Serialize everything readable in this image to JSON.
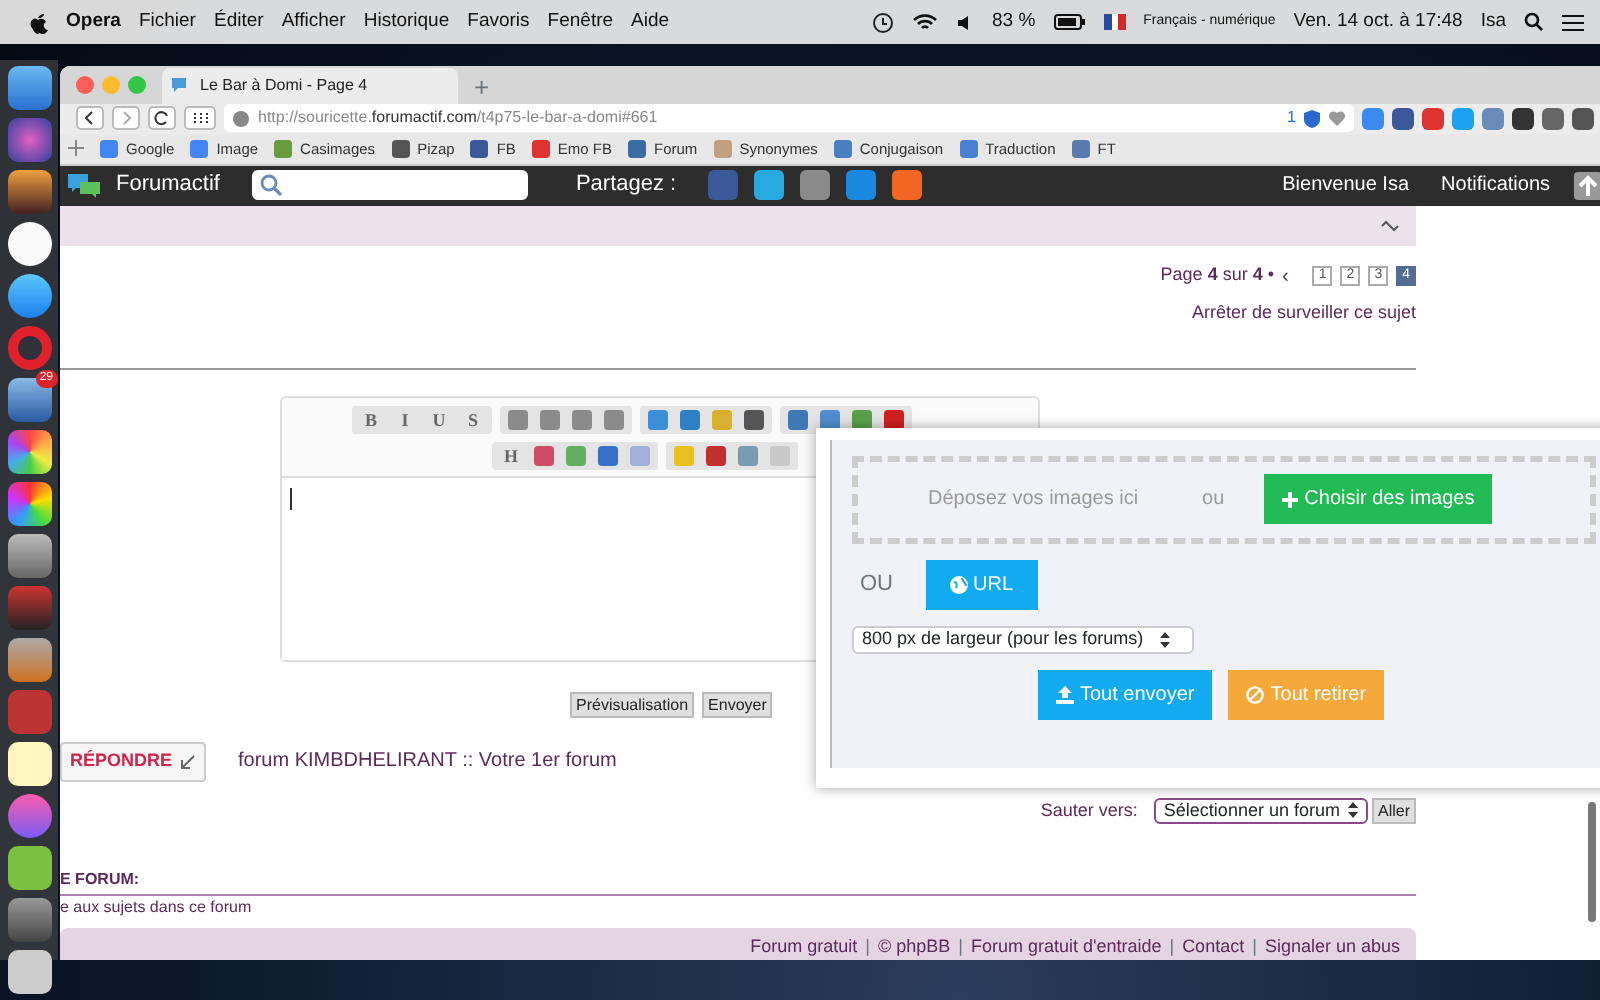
{
  "menubar": {
    "app": "Opera",
    "menus": [
      "Fichier",
      "Éditer",
      "Afficher",
      "Historique",
      "Favoris",
      "Fenêtre",
      "Aide"
    ],
    "battery": "83 %",
    "input_source": "Français - numérique",
    "clock": "Ven. 14 oct. à 17:48",
    "user": "Isa"
  },
  "dock": {
    "badge": "29"
  },
  "browser": {
    "tab": {
      "title": "Le Bar à Domi - Page 4",
      "new_tab": "+"
    },
    "url": "http://souricette.**forumactif.com**/t4p75-le-bar-a-domi#661",
    "shield_count": "1",
    "bookmarks": [
      "Google",
      "Image",
      "Casimages",
      "Pizap",
      "FB",
      "Emo FB",
      "Forum",
      "Synonymes",
      "Conjugaison",
      "Traduction",
      "FT"
    ]
  },
  "forum_nav": {
    "brand": "Forumactif",
    "share_label": "Partagez :",
    "welcome": "Bienvenue Isa",
    "notifications": "Notifications"
  },
  "pagination": {
    "label": "Page **4** sur **4** •",
    "prev": "‹",
    "pages": [
      {
        "label": "1",
        "selected": false
      },
      {
        "label": "2",
        "selected": false
      },
      {
        "label": "3",
        "selected": false
      },
      {
        "label": "4",
        "selected": true
      }
    ]
  },
  "watch_link": "Arrêter de surveiller ce sujet",
  "editor": {
    "toolbar": [
      [
        [
          {
            "kind": "text",
            "label": "B"
          },
          {
            "kind": "text",
            "label": "I"
          },
          {
            "kind": "text",
            "label": "U"
          },
          {
            "kind": "text",
            "label": "S"
          }
        ],
        [
          {
            "kind": "icon",
            "color": "#8a8a8a"
          },
          {
            "kind": "icon",
            "color": "#8a8a8a"
          },
          {
            "kind": "icon",
            "color": "#8a8a8a"
          },
          {
            "kind": "icon",
            "color": "#8a8a8a"
          }
        ],
        [
          {
            "kind": "icon",
            "color": "#3b8fd6"
          },
          {
            "kind": "icon",
            "color": "#2f7fc4"
          },
          {
            "kind": "icon",
            "color": "#d8b030"
          },
          {
            "kind": "icon",
            "color": "#555555"
          }
        ],
        [
          {
            "kind": "icon",
            "color": "#3f79b5"
          },
          {
            "kind": "icon",
            "color": "#4f8fcf"
          },
          {
            "kind": "icon",
            "color": "#5aa04a"
          },
          {
            "kind": "icon",
            "color": "#d02020"
          }
        ]
      ],
      [
        [
          {
            "kind": "text",
            "label": "H"
          },
          {
            "kind": "icon",
            "color": "#d04a6a"
          },
          {
            "kind": "icon",
            "color": "#60b060"
          },
          {
            "kind": "icon",
            "color": "#3a6fc8"
          },
          {
            "kind": "icon",
            "color": "#a0b0d8"
          }
        ],
        [
          {
            "kind": "icon",
            "color": "#e8c020"
          },
          {
            "kind": "icon",
            "color": "#c03030"
          },
          {
            "kind": "icon",
            "color": "#7a9ab0"
          },
          {
            "kind": "icon",
            "color": "#c8c8c8"
          }
        ]
      ]
    ],
    "buttons": [
      "Prévisualisation",
      "Envoyer"
    ]
  },
  "reply_button": "RÉPONDRE",
  "breadcrumb": "forum KIMBDHELIRANT :: Votre 1er forum",
  "jump": {
    "label": "Sauter vers:",
    "select": "Sélectionner un forum",
    "go": "Aller"
  },
  "section": {
    "title": "E FORUM:",
    "text": "e aux sujets dans ce forum"
  },
  "footer": [
    {
      "kind": "link",
      "text": "Forum gratuit"
    },
    {
      "kind": "sep",
      "text": "|"
    },
    {
      "kind": "link",
      "text": "© phpBB"
    },
    {
      "kind": "sep",
      "text": "|"
    },
    {
      "kind": "link",
      "text": "Forum gratuit d'entraide"
    },
    {
      "kind": "sep",
      "text": "|"
    },
    {
      "kind": "link",
      "text": "Contact"
    },
    {
      "kind": "sep",
      "text": "|"
    },
    {
      "kind": "link",
      "text": "Signaler un abus"
    }
  ],
  "upload": {
    "drop": "Déposez vos images ici",
    "or_drop": "ou",
    "choose": "Choisir des images",
    "or_url": "OU",
    "url": "URL",
    "size": "800 px de largeur (pour les forums)",
    "send_all": "Tout envoyer",
    "remove_all": "Tout retirer"
  }
}
